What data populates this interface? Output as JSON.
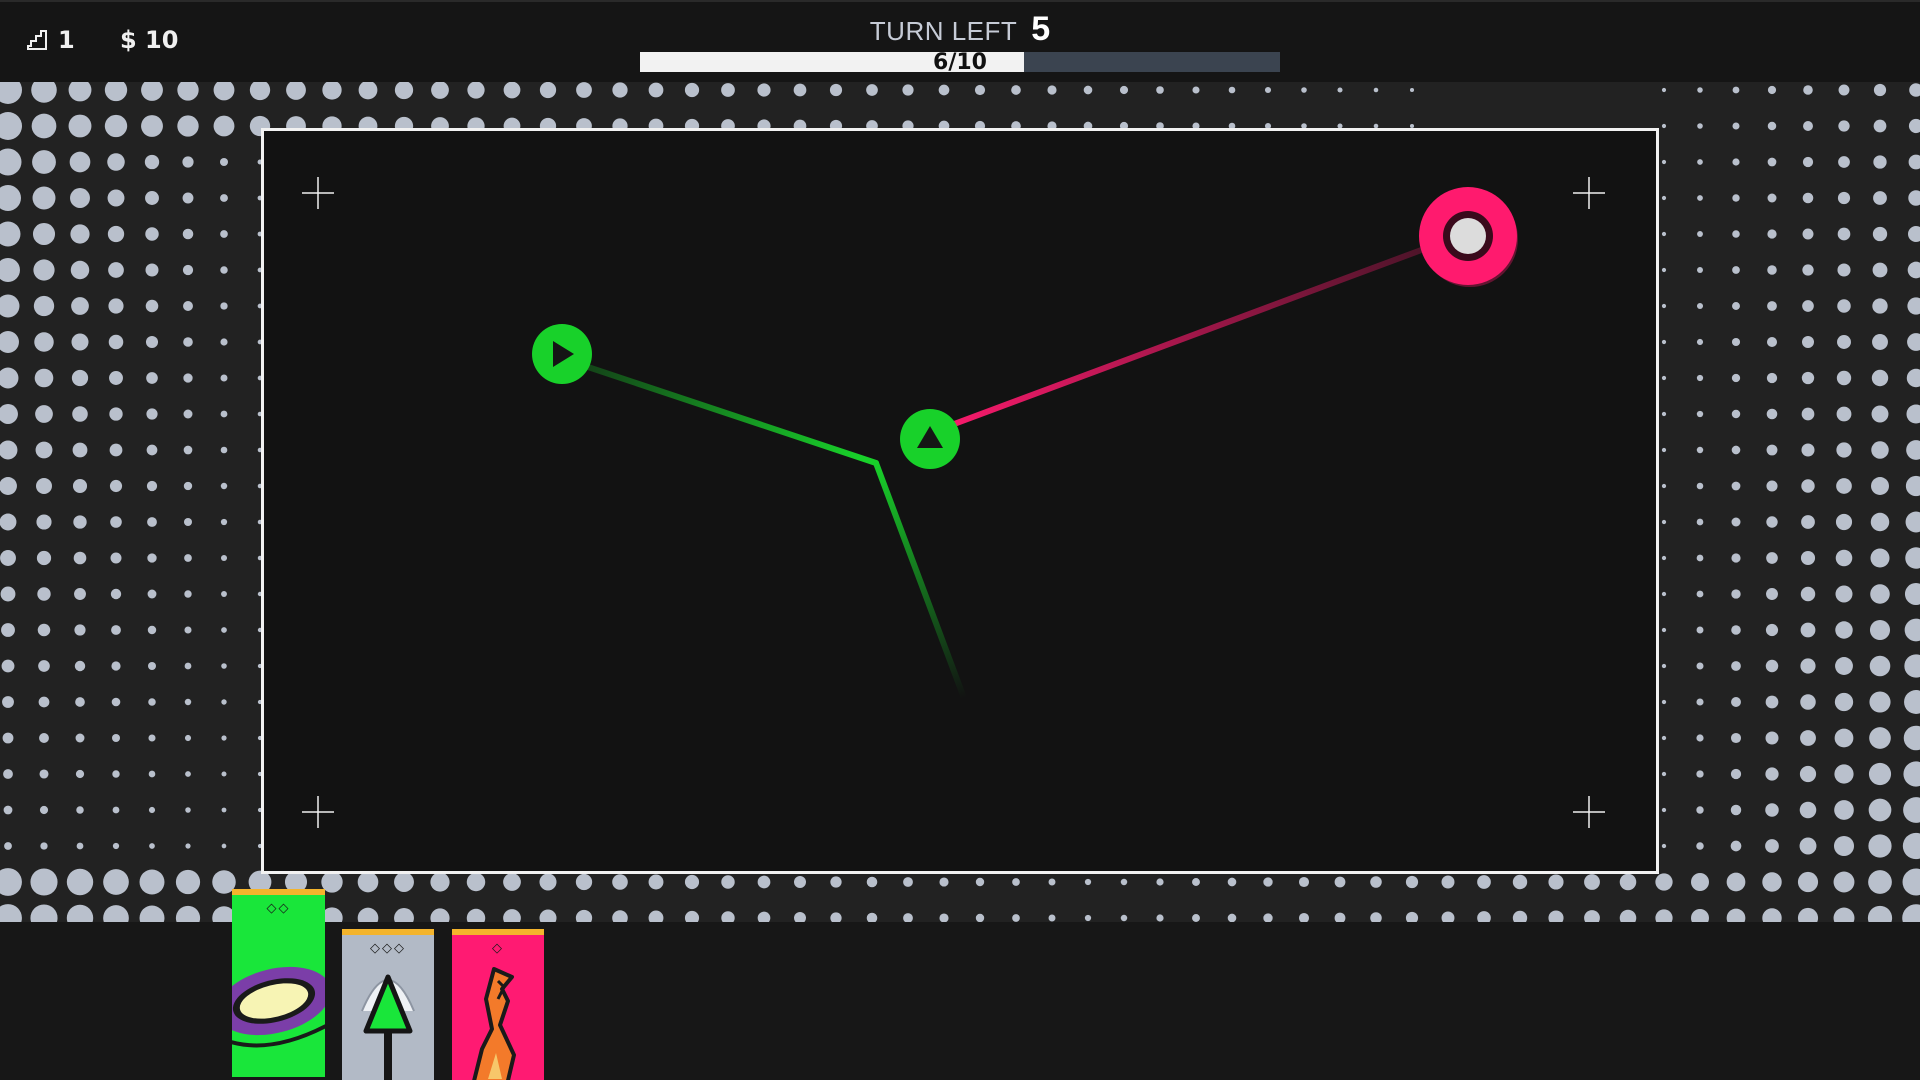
{
  "hud": {
    "level": "1",
    "money": "$ 10",
    "turn_label": "TURN LEFT",
    "turn_value": "5",
    "progress_text": "6/10",
    "progress_fraction": 0.6
  },
  "colors": {
    "green": "#18d12a",
    "pink": "#ff1a6e",
    "dots": "#b9c0cc",
    "card_green": "#19e63a",
    "card_silver": "#b2bac6",
    "card_pink": "#ff1a72"
  },
  "icons": {
    "level": "stairs-icon",
    "start_node": "play-icon",
    "mid_node": "triangle-up-icon",
    "target_node": "target-ring-icon"
  },
  "hand": {
    "cards": [
      {
        "name": "portal-card",
        "cost": "◇◇",
        "color": "green"
      },
      {
        "name": "arrow-card",
        "cost": "◇◇◇",
        "color": "silver"
      },
      {
        "name": "flame-card",
        "cost": "◇",
        "color": "pink"
      }
    ]
  }
}
